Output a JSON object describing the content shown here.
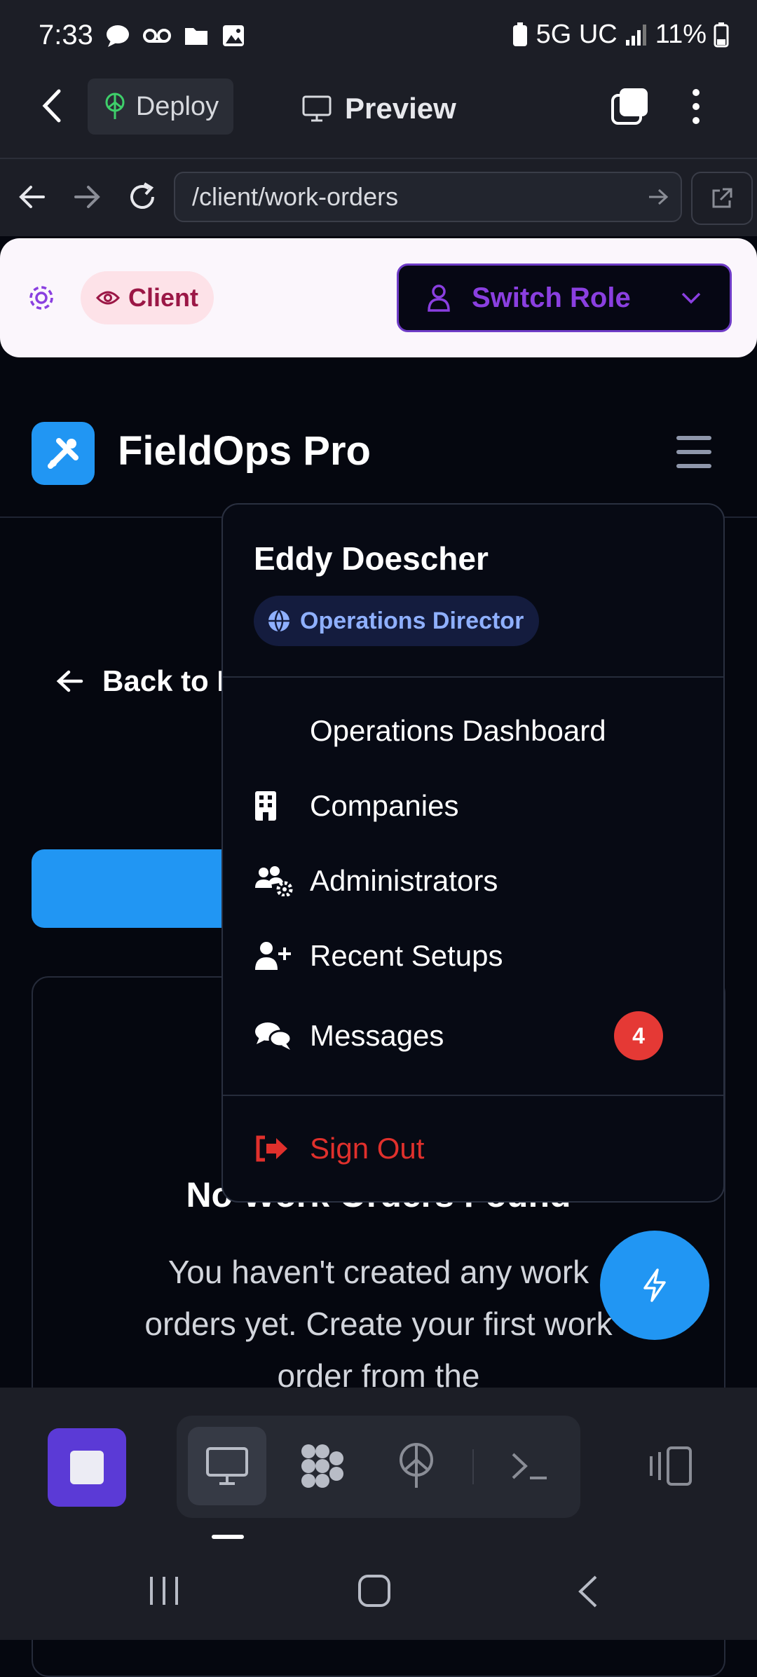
{
  "status_bar": {
    "time": "7:33",
    "network": "5G UC",
    "battery": "11%"
  },
  "top_bar": {
    "deploy_label": "Deploy",
    "preview_label": "Preview"
  },
  "url_bar": {
    "path": "/client/work-orders"
  },
  "role_bar": {
    "current_role": "Client",
    "switch_label": "Switch Role",
    "accent": "#8a3fe0"
  },
  "app": {
    "name": "FieldOps Pro",
    "back_label": "Back to D",
    "empty_title": "No Work Orders Found",
    "empty_desc": "You haven't created any work orders yet. Create your first work order from the"
  },
  "menu": {
    "user_name": "Eddy Doescher",
    "user_role": "Operations Director",
    "items": [
      {
        "label": "Operations Dashboard",
        "icon": "none"
      },
      {
        "label": "Companies",
        "icon": "building-icon"
      },
      {
        "label": "Administrators",
        "icon": "users-gear-icon"
      },
      {
        "label": "Recent Setups",
        "icon": "user-plus-icon"
      },
      {
        "label": "Messages",
        "icon": "chat-icon",
        "badge": "4"
      }
    ],
    "sign_out": "Sign Out"
  },
  "colors": {
    "brand_blue": "#2196f3",
    "danger": "#e0302c",
    "role_chip": "#9b1746"
  }
}
